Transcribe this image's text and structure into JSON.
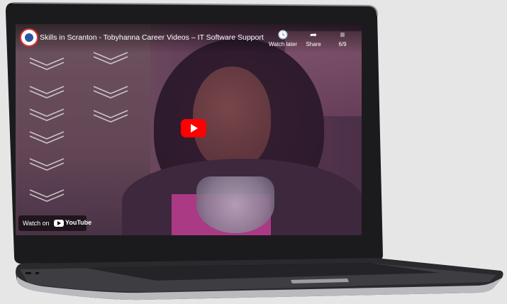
{
  "video": {
    "title": "Skills in Scranton - Tobyhanna Career Videos – IT Software Support",
    "actions": [
      {
        "label": "Watch later",
        "icon": "clock-icon"
      },
      {
        "label": "Share",
        "icon": "share-icon"
      },
      {
        "label": "6/9",
        "icon": "playlist-icon"
      }
    ],
    "watch_on": "Watch on",
    "platform": "YouTube"
  },
  "colors": {
    "play_button": "#ff0000",
    "tint": "#6e3c78"
  }
}
